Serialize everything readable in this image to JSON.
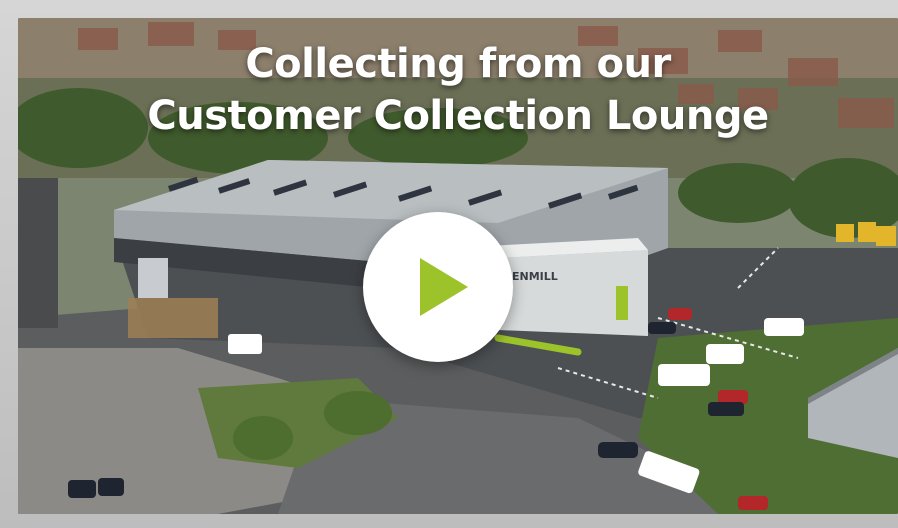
{
  "video": {
    "title_line1": "Collecting from our",
    "title_line2": "Customer Collection Lounge",
    "play_icon": "play-icon",
    "accent_color": "#9dc32b",
    "building_sign": "ENMILL"
  }
}
